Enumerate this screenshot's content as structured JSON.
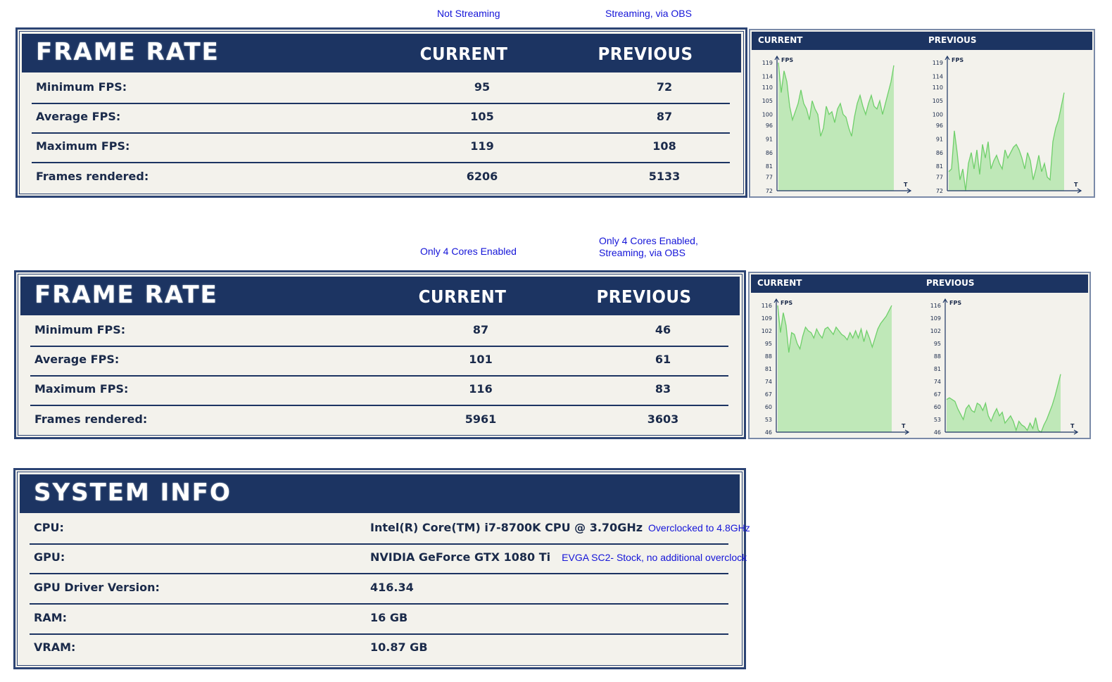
{
  "annotations": {
    "top_current": "Not Streaming",
    "top_previous": "Streaming, via OBS",
    "mid_current": "Only 4 Cores Enabled",
    "mid_previous_line1": "Only 4 Cores Enabled,",
    "mid_previous_line2": "Streaming, via OBS"
  },
  "frame_rate_1": {
    "title": "FRAME RATE",
    "col_current": "CURRENT",
    "col_previous": "PREVIOUS",
    "rows": [
      {
        "label": "Minimum FPS:",
        "current": "95",
        "previous": "72"
      },
      {
        "label": "Average FPS:",
        "current": "105",
        "previous": "87"
      },
      {
        "label": "Maximum FPS:",
        "current": "119",
        "previous": "108"
      },
      {
        "label": "Frames rendered:",
        "current": "6206",
        "previous": "5133"
      }
    ]
  },
  "frame_rate_2": {
    "title": "FRAME RATE",
    "col_current": "CURRENT",
    "col_previous": "PREVIOUS",
    "rows": [
      {
        "label": "Minimum FPS:",
        "current": "87",
        "previous": "46"
      },
      {
        "label": "Average FPS:",
        "current": "101",
        "previous": "61"
      },
      {
        "label": "Maximum FPS:",
        "current": "116",
        "previous": "83"
      },
      {
        "label": "Frames rendered:",
        "current": "5961",
        "previous": "3603"
      }
    ]
  },
  "system_info": {
    "title": "SYSTEM INFO",
    "rows": [
      {
        "label": "CPU:",
        "value": "Intel(R) Core(TM) i7-8700K CPU @ 3.70GHz",
        "note": "Overclocked to 4.8GHz"
      },
      {
        "label": "GPU:",
        "value": "NVIDIA GeForce GTX 1080 Ti",
        "note": "EVGA SC2- Stock, no additional overclock"
      },
      {
        "label": "GPU Driver Version:",
        "value": "416.34",
        "note": ""
      },
      {
        "label": "RAM:",
        "value": "16 GB",
        "note": ""
      },
      {
        "label": "VRAM:",
        "value": "10.87 GB",
        "note": ""
      }
    ]
  },
  "graph_labels": {
    "current": "CURRENT",
    "previous": "PREVIOUS",
    "y_unit": "FPS",
    "x_unit": "T"
  },
  "colors": {
    "navy": "#1c3462",
    "annotation_blue": "#1414d8",
    "graph_fill": "#bfe8b8",
    "graph_line": "#6fcf6a",
    "paper": "#f3f2ec"
  },
  "chart_data": [
    {
      "type": "area",
      "series_label": "CURRENT",
      "ylabel": "FPS",
      "xlabel": "T",
      "yticks": [
        72,
        77,
        81,
        86,
        91,
        96,
        100,
        105,
        110,
        114,
        119
      ],
      "ylim": [
        72,
        119
      ],
      "values": [
        119,
        108,
        116,
        112,
        103,
        98,
        101,
        104,
        109,
        104,
        102,
        98,
        105,
        102,
        100,
        92,
        95,
        103,
        100,
        101,
        97,
        102,
        104,
        100,
        99,
        95,
        92,
        99,
        104,
        107,
        103,
        100,
        104,
        107,
        103,
        102,
        105,
        100,
        104,
        108,
        112,
        118
      ]
    },
    {
      "type": "area",
      "series_label": "PREVIOUS",
      "ylabel": "FPS",
      "xlabel": "T",
      "yticks": [
        72,
        77,
        81,
        86,
        91,
        96,
        100,
        105,
        110,
        114,
        119
      ],
      "ylim": [
        72,
        119
      ],
      "values": [
        79,
        80,
        94,
        86,
        76,
        80,
        72,
        82,
        86,
        80,
        87,
        78,
        89,
        84,
        90,
        80,
        83,
        85,
        82,
        80,
        87,
        84,
        86,
        88,
        89,
        87,
        84,
        80,
        86,
        83,
        76,
        80,
        85,
        79,
        82,
        77,
        76,
        90,
        95,
        98,
        103,
        108
      ]
    },
    {
      "type": "area",
      "series_label": "CURRENT",
      "ylabel": "FPS",
      "xlabel": "T",
      "yticks": [
        46,
        53,
        60,
        67,
        74,
        81,
        88,
        95,
        102,
        109,
        116
      ],
      "ylim": [
        46,
        116
      ],
      "values": [
        116,
        101,
        112,
        105,
        90,
        101,
        100,
        95,
        92,
        99,
        104,
        102,
        101,
        98,
        103,
        100,
        98,
        103,
        104,
        102,
        100,
        104,
        102,
        100,
        99,
        97,
        101,
        98,
        102,
        98,
        103,
        96,
        102,
        98,
        93,
        98,
        103,
        106,
        108,
        110,
        113,
        116
      ]
    },
    {
      "type": "area",
      "series_label": "PREVIOUS",
      "ylabel": "FPS",
      "xlabel": "T",
      "yticks": [
        46,
        53,
        60,
        67,
        74,
        81,
        88,
        95,
        102,
        109,
        116
      ],
      "ylim": [
        46,
        116
      ],
      "values": [
        64,
        65,
        64,
        63,
        59,
        56,
        53,
        59,
        61,
        58,
        57,
        62,
        61,
        58,
        62,
        55,
        52,
        56,
        59,
        55,
        57,
        51,
        53,
        55,
        52,
        47,
        52,
        50,
        49,
        47,
        51,
        48,
        54,
        47,
        46,
        50,
        53,
        57,
        61,
        66,
        72,
        78
      ]
    }
  ]
}
